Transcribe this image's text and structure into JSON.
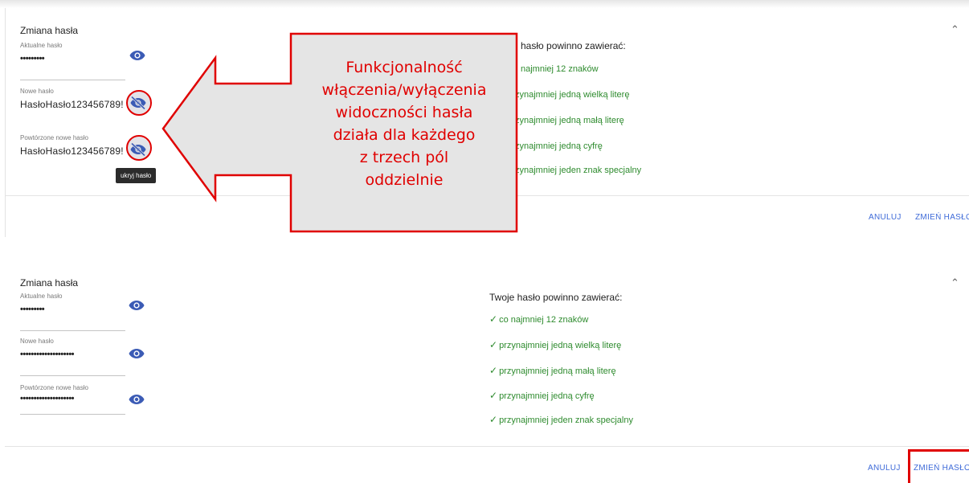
{
  "top": {
    "title": "Zmiana hasła",
    "current_label": "Aktualne hasło",
    "current_value": "•••••••••",
    "new_label": "Nowe hasło",
    "new_value": "HasłoHasło123456789!",
    "repeat_label": "Powtórzone nowe hasło",
    "repeat_value": "HasłoHasło123456789!",
    "tooltip": "ukryj hasło",
    "requirements_title": "hasło powinno zawierać:",
    "requirements": [
      "najmniej 12 znaków",
      "zynajmniej jedną wielką literę",
      "zynajmniej jedną małą literę",
      "zynajmniej jedną cyfrę",
      "zynajmniej jeden znak specjalny"
    ],
    "cancel": "ANULUJ",
    "submit": "ZMIEŃ HASŁO"
  },
  "callout": {
    "lines": [
      "Funkcjonalność",
      "włączenia/wyłączenia",
      "widoczności hasła",
      "działa dla każdego",
      "z trzech pól",
      "oddzielnie"
    ],
    "color": "#e00000",
    "fill": "#e5e5e5"
  },
  "bottom": {
    "title": "Zmiana hasła",
    "current_label": "Aktualne hasło",
    "current_value": "•••••••••",
    "new_label": "Nowe hasło",
    "new_value": "••••••••••••••••••••",
    "repeat_label": "Powtórzone nowe hasło",
    "repeat_value": "••••••••••••••••••••",
    "requirements_title": "Twoje hasło powinno zawierać:",
    "requirements": [
      "co najmniej 12 znaków",
      "przynajmniej jedną wielką literę",
      "przynajmniej jedną małą literę",
      "przynajmniej jedną cyfrę",
      "przynajmniej jeden znak specjalny"
    ],
    "cancel": "ANULUJ",
    "submit": "ZMIEŃ HASŁO"
  },
  "icons": {
    "chevron": "chevron-up-icon",
    "eye": "eye-icon",
    "eye_off": "eye-off-icon",
    "check": "check-icon"
  },
  "colors": {
    "accent": "#3f6bd8",
    "success": "#2e8b2e",
    "annotation": "#e00000",
    "eye_icon": "#3b5bb5"
  }
}
